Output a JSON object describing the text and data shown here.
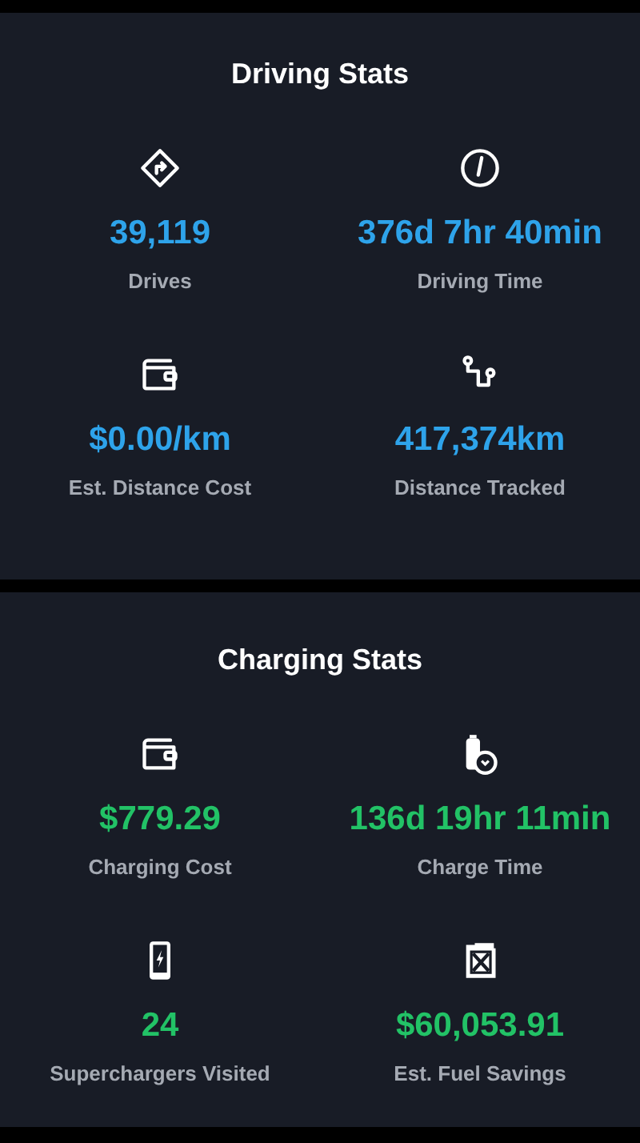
{
  "sections": [
    {
      "kind": "driving",
      "title": "Driving Stats",
      "stats": [
        {
          "value": "39,119",
          "label": "Drives"
        },
        {
          "value": "376d 7hr 40min",
          "label": "Driving Time"
        },
        {
          "value": "$0.00/km",
          "label": "Est. Distance Cost"
        },
        {
          "value": "417,374km",
          "label": "Distance Tracked"
        }
      ]
    },
    {
      "kind": "charging",
      "title": "Charging Stats",
      "stats": [
        {
          "value": "$779.29",
          "label": "Charging Cost"
        },
        {
          "value": "136d 19hr 11min",
          "label": "Charge Time"
        },
        {
          "value": "24",
          "label": "Superchargers Visited"
        },
        {
          "value": "$60,053.91",
          "label": "Est. Fuel Savings"
        }
      ]
    }
  ]
}
